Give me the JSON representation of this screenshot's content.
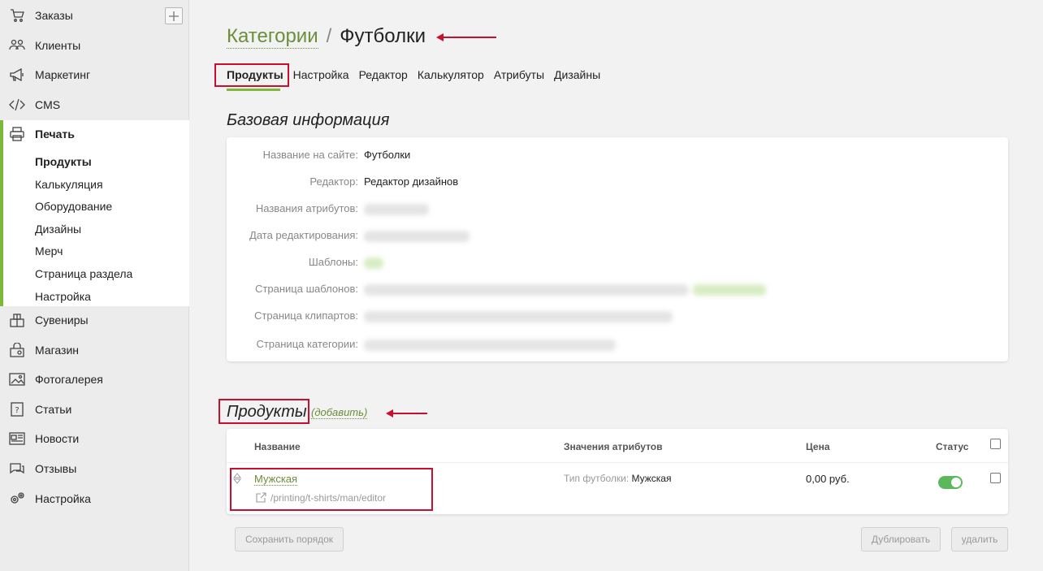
{
  "sidebar": {
    "items": [
      {
        "label": "Заказы",
        "icon": "cart-icon"
      },
      {
        "label": "Клиенты",
        "icon": "users-icon"
      },
      {
        "label": "Маркетинг",
        "icon": "megaphone-icon"
      },
      {
        "label": "CMS",
        "icon": "code-icon"
      },
      {
        "label": "Печать",
        "icon": "printer-icon"
      },
      {
        "label": "Сувениры",
        "icon": "gift-icon"
      },
      {
        "label": "Магазин",
        "icon": "shop-icon"
      },
      {
        "label": "Фотогалерея",
        "icon": "gallery-icon"
      },
      {
        "label": "Статьи",
        "icon": "article-icon"
      },
      {
        "label": "Новости",
        "icon": "news-icon"
      },
      {
        "label": "Отзывы",
        "icon": "reviews-icon"
      },
      {
        "label": "Настройка",
        "icon": "settings-icon"
      }
    ],
    "print_sub": [
      "Продукты",
      "Калькуляция",
      "Оборудование",
      "Дизайны",
      "Мерч",
      "Страница раздела",
      "Настройка"
    ]
  },
  "breadcrumb": {
    "parent": "Категории",
    "separator": "/",
    "current": "Футболки"
  },
  "tabs": [
    "Продукты",
    "Настройка",
    "Редактор",
    "Калькулятор",
    "Атрибуты",
    "Дизайны"
  ],
  "base_info": {
    "title": "Базовая информация",
    "rows": [
      {
        "label": "Название на сайте:",
        "value": "Футболки"
      },
      {
        "label": "Редактор:",
        "value": "Редактор дизайнов"
      },
      {
        "label": "Названия атрибутов:",
        "value": ""
      },
      {
        "label": "Дата редактирования:",
        "value": ""
      },
      {
        "label": "Шаблоны:",
        "value": ""
      },
      {
        "label": "Страница шаблонов:",
        "value": ""
      },
      {
        "label": "Страница клипартов:",
        "value": ""
      },
      {
        "label": "Страница категории:",
        "value": ""
      }
    ]
  },
  "products": {
    "title": "Продукты",
    "add_label": "(добавить)",
    "columns": {
      "name": "Название",
      "attrs": "Значения атрибутов",
      "price": "Цена",
      "status": "Статус"
    },
    "rows": [
      {
        "name": "Мужская",
        "path": "/printing/t-shirts/man/editor",
        "attr_key": "Тип футболки:",
        "attr_value": "Мужская",
        "price": "0,00 руб.",
        "status_on": true
      }
    ],
    "buttons": {
      "save_order": "Сохранить порядок",
      "duplicate": "Дублировать",
      "delete": "удалить"
    }
  },
  "colors": {
    "accent": "#7cb93a",
    "link": "#6b8f3a",
    "annotation": "#c8102e",
    "toggle_on": "#5cb85c"
  }
}
